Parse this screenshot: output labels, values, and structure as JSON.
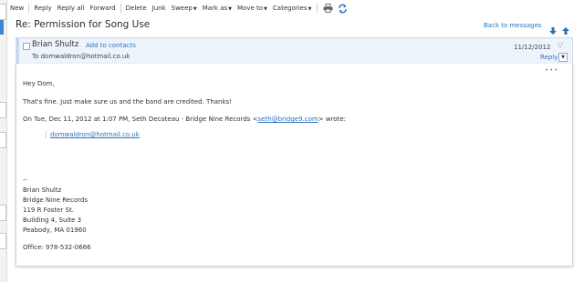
{
  "toolbar": {
    "new": "New",
    "reply": "Reply",
    "reply_all": "Reply all",
    "forward": "Forward",
    "delete": "Delete",
    "junk": "Junk",
    "sweep": "Sweep",
    "mark_as": "Mark as",
    "move_to": "Move to",
    "categories": "Categories",
    "print_icon": "printer-icon",
    "refresh_icon": "sync-icon"
  },
  "message": {
    "subject": "Re: Permission for Song Use",
    "back_link": "Back to messages",
    "sender": "Brian Shultz",
    "add_contacts": "Add to contacts",
    "to_line": "To domwaldron@hotmail.co.uk",
    "date": "11/12/2012",
    "reply": "Reply"
  },
  "body": {
    "greeting": "Hey Dom,",
    "line1": "That's fine. Just make sure us and the band are credited. Thanks!",
    "quote_prefix": "On Tue, Dec 11, 2012 at 1:07 PM, Seth Decoteau - Bridge Nine Records <",
    "quote_email": "seth@bridge9.com",
    "quote_suffix": "> wrote:",
    "quoted_email": "domwaldron@hotmail.co.uk",
    "sig_dashes": "--",
    "sig_name": "Brian Shultz",
    "sig_company": "Bridge Nine Records",
    "sig_street": "119 R Foster St.",
    "sig_building": "Building 4, Suite 3",
    "sig_city": "Peabody, MA 01960",
    "sig_office": "Office: 978-532-0666"
  },
  "colors": {
    "accent": "#2a72c1",
    "header_bg": "#eef4fb"
  }
}
